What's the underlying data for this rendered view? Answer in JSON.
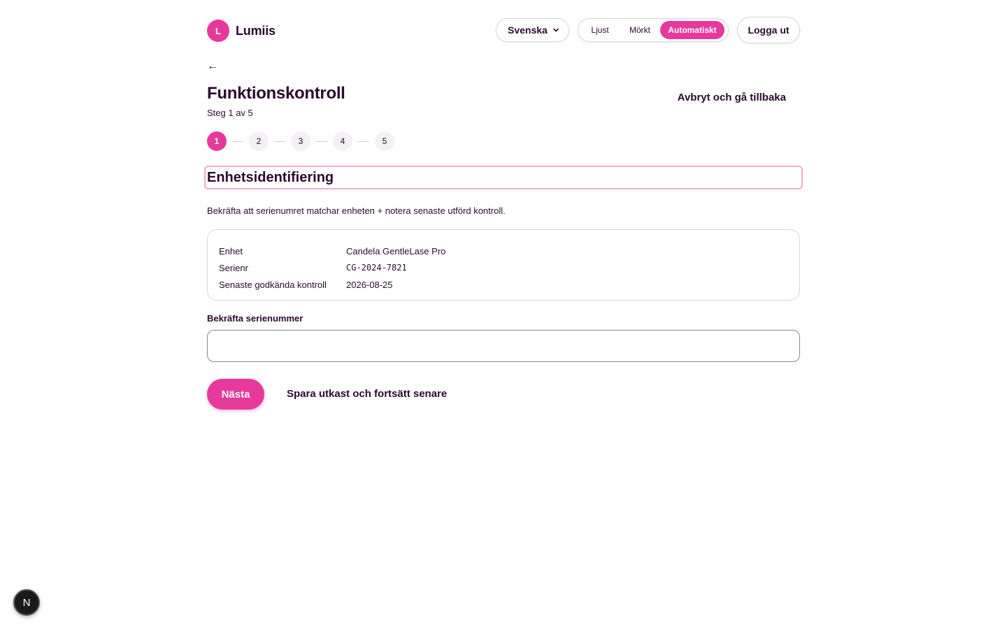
{
  "header": {
    "brand_initial": "L",
    "brand_name": "Lumiis",
    "language": "Svenska",
    "theme_options": [
      "Ljust",
      "Mörkt",
      "Automatiskt"
    ],
    "theme_selected": "Automatiskt",
    "logout_label": "Logga ut"
  },
  "nav": {
    "back_arrow": "←"
  },
  "page": {
    "title": "Funktionskontroll",
    "step_text": "Steg 1 av 5",
    "cancel_label": "Avbryt och gå tillbaka"
  },
  "stepper": {
    "steps": [
      "1",
      "2",
      "3",
      "4",
      "5"
    ],
    "current": 1
  },
  "section": {
    "title": "Enhetsidentifiering",
    "description": "Bekräfta att serienumret matchar enheten + notera senaste utförd kontroll."
  },
  "device_info": [
    {
      "label": "Enhet",
      "value": "Candela GentleLase Pro"
    },
    {
      "label": "Serienr",
      "value": "CG-2024-7821"
    },
    {
      "label": "Senaste godkända kontroll",
      "value": "2026-08-25"
    }
  ],
  "form": {
    "serial_label": "Bekräfta serienummer",
    "serial_value": "",
    "serial_placeholder": ""
  },
  "actions": {
    "next_label": "Nästa",
    "draft_label": "Spara utkast och fortsätt senare"
  },
  "dev_badge": {
    "letter": "N"
  },
  "colors": {
    "accent": "#e6399b",
    "text": "#2a0a2e",
    "section_border": "#f2a8cf"
  }
}
